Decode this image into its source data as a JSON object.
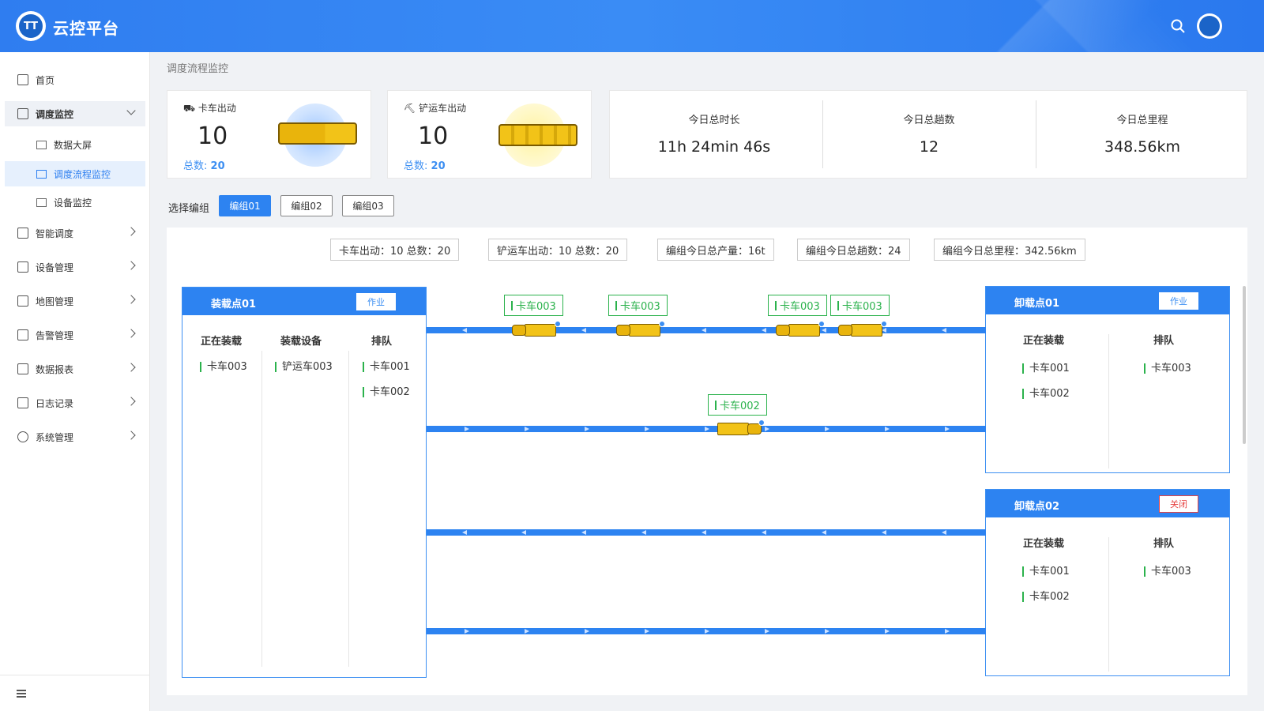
{
  "app": {
    "title": "云控平台",
    "logo_text": "TT"
  },
  "header": {
    "icons": [
      "search-icon",
      "avatar"
    ]
  },
  "sidebar": {
    "items": [
      {
        "label": "首页",
        "icon": "home-icon"
      },
      {
        "label": "调度监控",
        "icon": "monitor-icon",
        "expanded": true,
        "children": [
          {
            "label": "数据大屏",
            "icon": "chart-icon"
          },
          {
            "label": "调度流程监控",
            "icon": "trend-icon",
            "selected": true
          },
          {
            "label": "设备监控",
            "icon": "device-monitor-icon"
          }
        ]
      },
      {
        "label": "智能调度",
        "icon": "smart-dispatch-icon"
      },
      {
        "label": "设备管理",
        "icon": "device-icon"
      },
      {
        "label": "地图管理",
        "icon": "map-icon"
      },
      {
        "label": "告警管理",
        "icon": "bell-icon"
      },
      {
        "label": "数据报表",
        "icon": "report-icon"
      },
      {
        "label": "日志记录",
        "icon": "log-icon"
      },
      {
        "label": "系统管理",
        "icon": "settings-icon"
      }
    ]
  },
  "breadcrumb": "调度流程监控",
  "stats": {
    "truck": {
      "title": "卡车出动",
      "value": "10",
      "total_label": "总数:",
      "total": "20"
    },
    "loader": {
      "title": "铲运车出动",
      "value": "10",
      "total_label": "总数:",
      "total": "20"
    }
  },
  "summary": [
    {
      "label": "今日总时长",
      "value": "11h 24min 46s"
    },
    {
      "label": "今日总趟数",
      "value": "12"
    },
    {
      "label": "今日总里程",
      "value": "348.56km"
    }
  ],
  "group_select": {
    "label": "选择编组",
    "tabs": [
      "编组01",
      "编组02",
      "编组03"
    ],
    "active": 0
  },
  "group_info": [
    "卡车出动：10   总数：20",
    "铲运车出动：10   总数：20",
    "编组今日总产量：16t",
    "编组今日总趟数：24",
    "编组今日总里程：342.56km"
  ],
  "loading_site": {
    "title": "装载点01",
    "button": "作业",
    "columns": [
      "正在装载",
      "装载设备",
      "排队"
    ],
    "loading": [
      "卡车003"
    ],
    "equipment": [
      "铲运车003"
    ],
    "queue": [
      "卡车001",
      "卡车002"
    ]
  },
  "unloading_sites": [
    {
      "title": "卸载点01",
      "button": "作业",
      "columns": [
        "正在装载",
        "排队"
      ],
      "loading": [
        "卡车001",
        "卡车002"
      ],
      "queue": [
        "卡车003"
      ]
    },
    {
      "title": "卸载点02",
      "button": "关闭",
      "columns": [
        "正在装载",
        "排队"
      ],
      "loading": [
        "卡车001",
        "卡车002"
      ],
      "queue": [
        "卡车003"
      ]
    }
  ],
  "lanes": {
    "lane1_trucks": [
      "卡车003",
      "卡车003",
      "卡车003",
      "卡车003"
    ],
    "lane2_trucks": [
      "卡车002"
    ]
  },
  "colors": {
    "primary": "#2d83f1",
    "tag_green": "#2bb24c",
    "danger": "#e64242",
    "vehicle_yellow": "#f2c318"
  }
}
